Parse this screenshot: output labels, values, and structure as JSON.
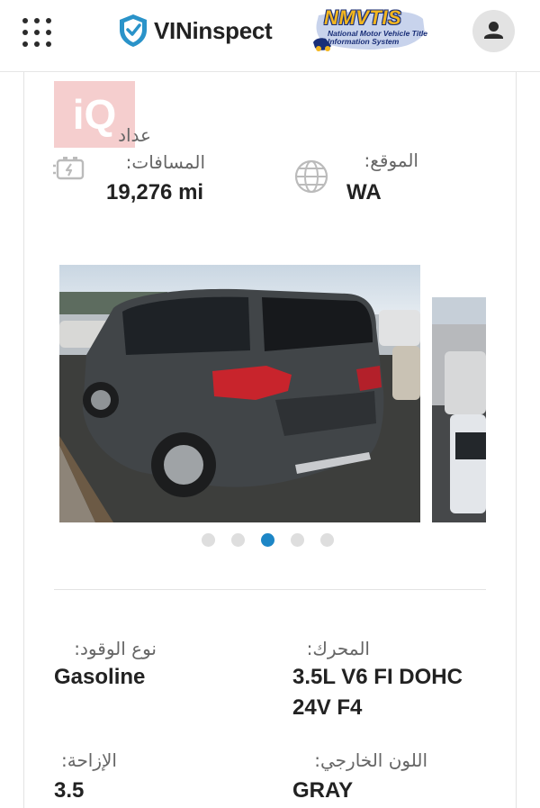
{
  "header": {
    "brand_name": "VINinspect",
    "menu_icon": "grid-dots-icon",
    "brand_icon": "shield-check-icon",
    "nmvtis": {
      "title": "NMVTIS",
      "subtitle": "National Motor Vehicle Title Information System"
    },
    "account_icon": "user-icon"
  },
  "watermark": {
    "text": "iQ"
  },
  "stats": {
    "odometer": {
      "label": "عداد المسافات:",
      "label_line1": "عداد",
      "label_line2": "المسافات:",
      "value": "19,276 mi",
      "icon": "battery-gauge-icon"
    },
    "location": {
      "label": "الموقع:",
      "value": "WA",
      "icon": "globe-icon"
    }
  },
  "carousel": {
    "slides": [
      "nissan-pathfinder-rear-photo",
      "next-vehicle-photo"
    ],
    "dot_count": 5,
    "active_index": 2
  },
  "details": {
    "fuel": {
      "label": "نوع الوقود:",
      "value": "Gasoline"
    },
    "engine": {
      "label": "المحرك:",
      "value_line1": "3.5L V6 FI DOHC",
      "value_line2": "24V F4"
    },
    "displacement": {
      "label": "الإزاحة:",
      "value": "3.5"
    },
    "exterior_color": {
      "label": "اللون الخارجي:",
      "value": "GRAY"
    }
  },
  "colors": {
    "accent": "#1d86c6",
    "brand_shield": "#2a93c9",
    "nmvtis_gold": "#f3b61f",
    "nmvtis_navy": "#1a2f78",
    "watermark": "#f5c9c9"
  }
}
